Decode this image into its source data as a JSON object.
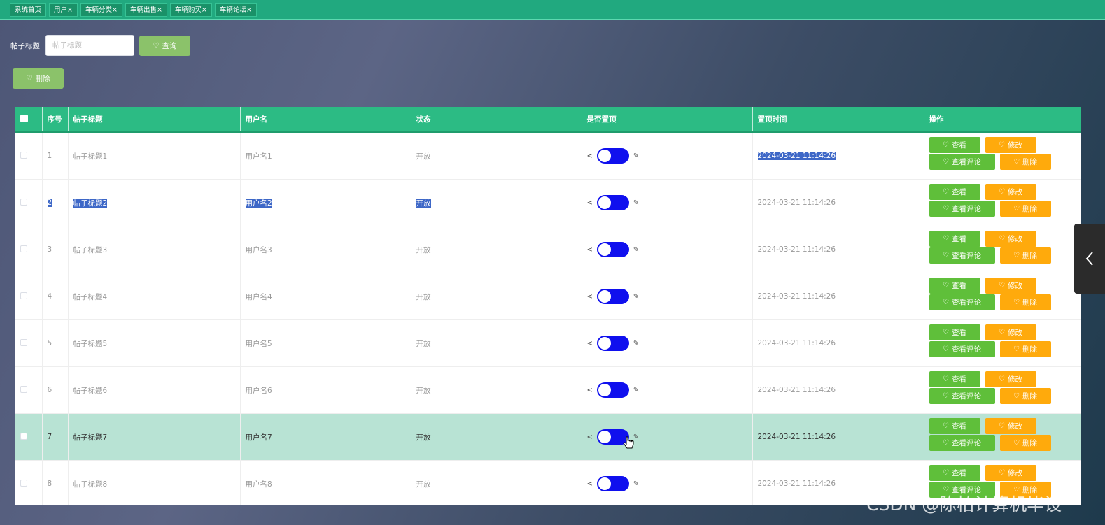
{
  "tabs": [
    {
      "label": "系统首页"
    },
    {
      "label": "用户×"
    },
    {
      "label": "车辆分类×"
    },
    {
      "label": "车辆出售×"
    },
    {
      "label": "车辆购买×"
    },
    {
      "label": "车辆论坛×"
    }
  ],
  "search": {
    "label": "帖子标题",
    "placeholder": "帖子标题",
    "value": "",
    "query_label": "查询"
  },
  "toolbar": {
    "delete_label": "删除"
  },
  "table": {
    "columns": [
      "序号",
      "帖子标题",
      "用户名",
      "状态",
      "是否置顶",
      "置顶时间",
      "操作"
    ],
    "rows": [
      {
        "no": "1",
        "title": "帖子标题1",
        "user": "用户名1",
        "status": "开放",
        "pinned": true,
        "time": "2024-03-21 11:14:26"
      },
      {
        "no": "2",
        "title": "帖子标题2",
        "user": "用户名2",
        "status": "开放",
        "pinned": true,
        "time": "2024-03-21 11:14:26"
      },
      {
        "no": "3",
        "title": "帖子标题3",
        "user": "用户名3",
        "status": "开放",
        "pinned": true,
        "time": "2024-03-21 11:14:26"
      },
      {
        "no": "4",
        "title": "帖子标题4",
        "user": "用户名4",
        "status": "开放",
        "pinned": true,
        "time": "2024-03-21 11:14:26"
      },
      {
        "no": "5",
        "title": "帖子标题5",
        "user": "用户名5",
        "status": "开放",
        "pinned": true,
        "time": "2024-03-21 11:14:26"
      },
      {
        "no": "6",
        "title": "帖子标题6",
        "user": "用户名6",
        "status": "开放",
        "pinned": true,
        "time": "2024-03-21 11:14:26"
      },
      {
        "no": "7",
        "title": "帖子标题7",
        "user": "用户名7",
        "status": "开放",
        "pinned": true,
        "time": "2024-03-21 11:14:26"
      },
      {
        "no": "8",
        "title": "帖子标题8",
        "user": "用户名8",
        "status": "开放",
        "pinned": true,
        "time": "2024-03-21 11:14:26"
      }
    ],
    "actions": {
      "view": "查看",
      "edit": "修改",
      "comments": "查看评论",
      "delete": "删除"
    }
  },
  "watermark": "CSDN @陈柏计算机毕设",
  "colors": {
    "header_green": "#2cbb84",
    "topbar_green": "#21a97f",
    "action_green": "#5fbf3a",
    "action_orange": "#ffaa0c",
    "switch_blue": "#1010ee",
    "hover_row": "#b8e3d4",
    "text_selection": "#3d67c7"
  }
}
